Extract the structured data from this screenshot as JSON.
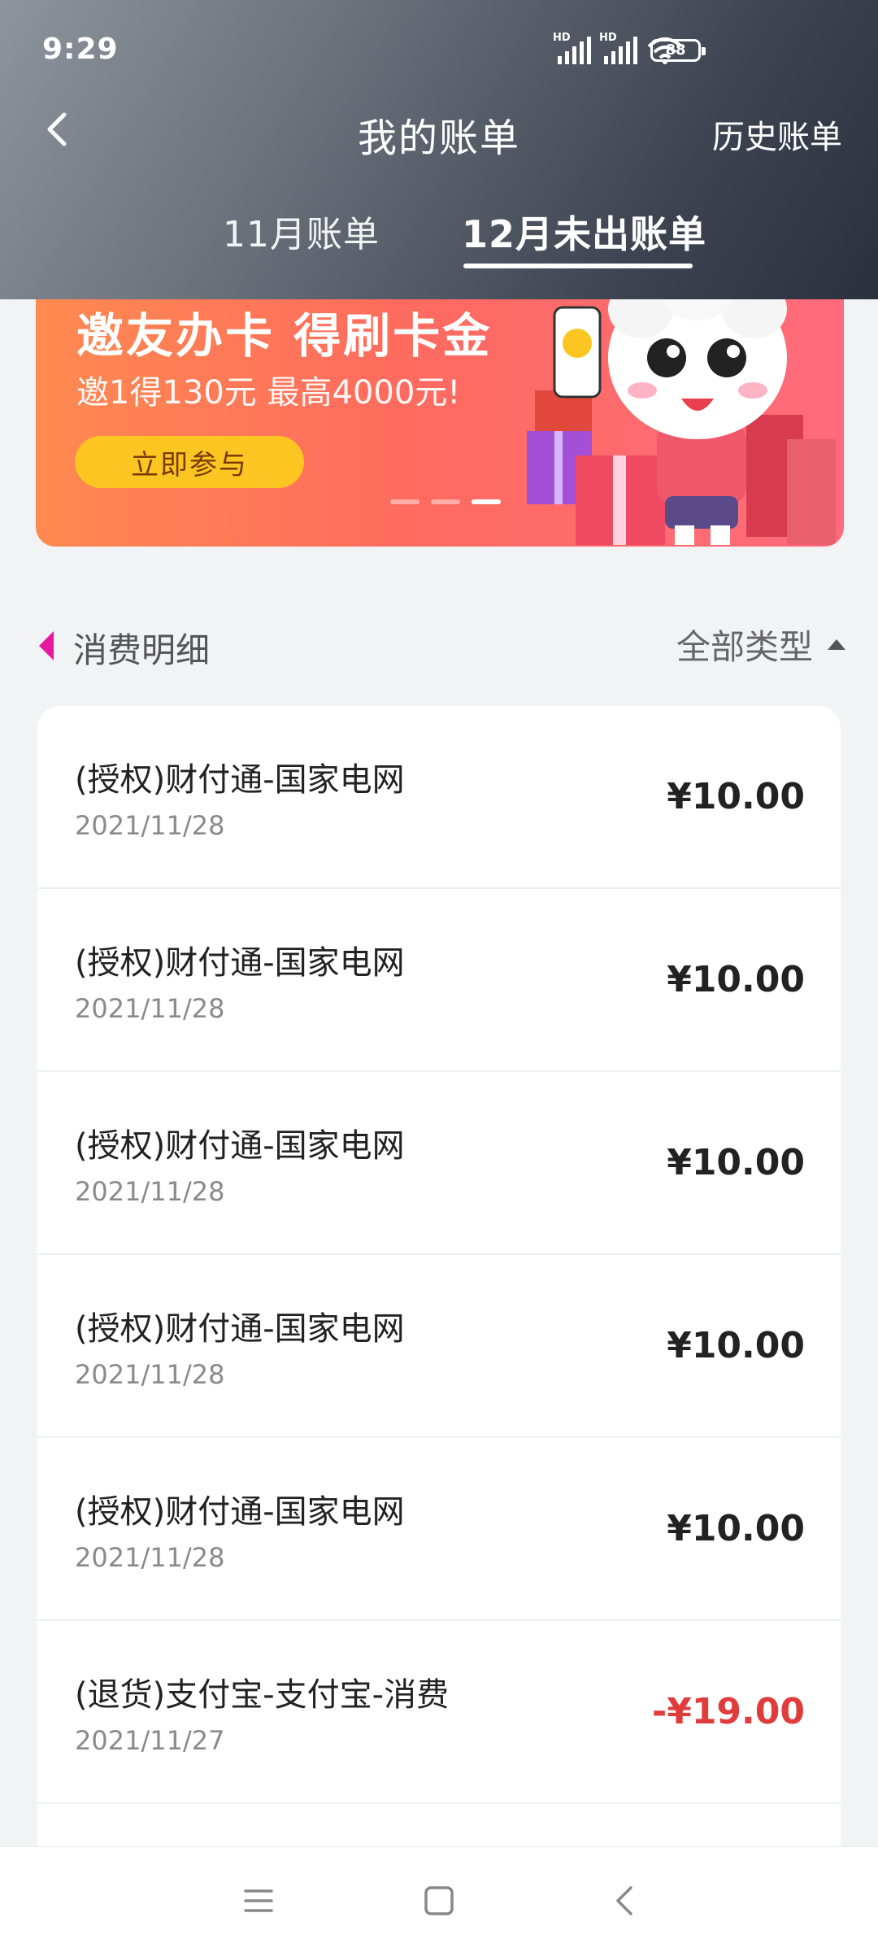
{
  "status": {
    "time": "9:29",
    "battery": "88"
  },
  "nav": {
    "title": "我的账单",
    "history": "历史账单"
  },
  "tabs": [
    {
      "label": "11月账单"
    },
    {
      "label": "12月未出账单"
    }
  ],
  "banner": {
    "title": "邀友办卡 得刷卡金",
    "subtitle": "邀1得130元  最高4000元!",
    "button": "立即参与",
    "dots": 3,
    "active_dot": 3
  },
  "section": {
    "title": "消费明细",
    "filter": "全部类型"
  },
  "transactions": [
    {
      "name": "(授权)财付通-国家电网",
      "date": "2021/11/28",
      "amount": "¥10.00"
    },
    {
      "name": "(授权)财付通-国家电网",
      "date": "2021/11/28",
      "amount": "¥10.00"
    },
    {
      "name": "(授权)财付通-国家电网",
      "date": "2021/11/28",
      "amount": "¥10.00"
    },
    {
      "name": "(授权)财付通-国家电网",
      "date": "2021/11/28",
      "amount": "¥10.00"
    },
    {
      "name": "(授权)财付通-国家电网",
      "date": "2021/11/28",
      "amount": "¥10.00"
    },
    {
      "name": "(退货)支付宝-支付宝-消费",
      "date": "2021/11/27",
      "amount": "-¥19.00"
    }
  ],
  "colors": {
    "header_dark": "#2b303d",
    "section_marker": "#e8199f",
    "refund": "#e03c3c",
    "banner_button": "#fcc521"
  }
}
